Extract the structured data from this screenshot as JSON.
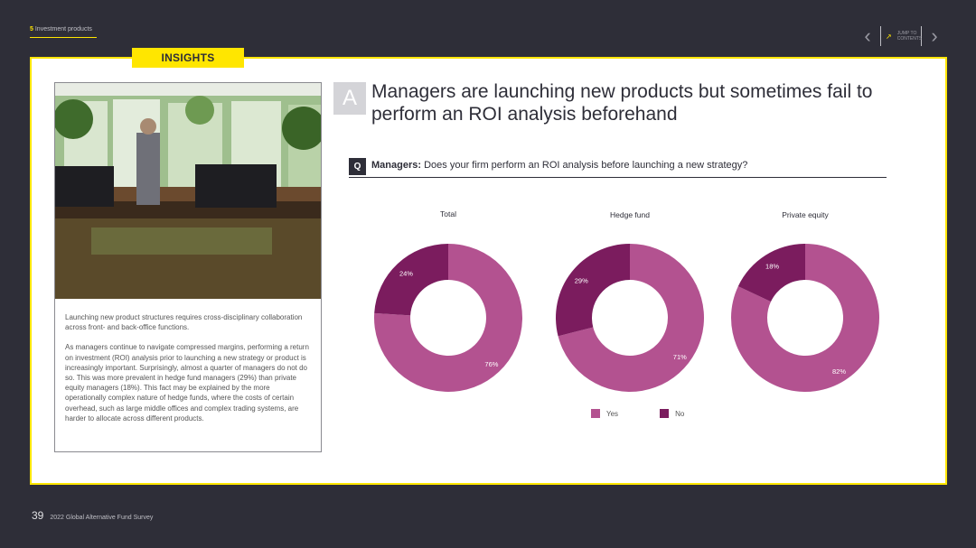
{
  "section": {
    "number": "5",
    "label": "Investment products"
  },
  "nav": {
    "prev_label": "‹",
    "next_label": "›",
    "jump_label": "JUMP TO CONTENTS"
  },
  "tag": "INSIGHTS",
  "card": {
    "paragraph1": "Launching new product structures requires cross-disciplinary collaboration across front- and back-office functions.",
    "paragraph2": "As managers continue to navigate compressed margins, performing a return on investment (ROI) analysis prior to launching a new strategy or product is increasingly important. Surprisingly, almost a quarter of managers do not do so. This was more prevalent in hedge fund managers (29%) than private equity managers (18%). This fact may be explained by the more operationally complex nature of hedge funds, where the costs of certain overhead, such as large middle offices and complex trading systems, are harder to allocate across different products."
  },
  "answer_letter": "A",
  "headline": "Managers are launching new products but sometimes fail to perform an ROI analysis beforehand",
  "question": {
    "letter": "Q",
    "prefix": "Managers:",
    "text": "Does your firm perform an ROI analysis before launching a new strategy?"
  },
  "colors": {
    "yes": "#b35290",
    "no": "#7b1c5e"
  },
  "chart_data": [
    {
      "type": "pie",
      "title": "Total",
      "categories": [
        "Yes",
        "No"
      ],
      "values": [
        76,
        24
      ],
      "labels": [
        "76%",
        "24%"
      ]
    },
    {
      "type": "pie",
      "title": "Hedge fund",
      "categories": [
        "Yes",
        "No"
      ],
      "values": [
        71,
        29
      ],
      "labels": [
        "71%",
        "29%"
      ]
    },
    {
      "type": "pie",
      "title": "Private equity",
      "categories": [
        "Yes",
        "No"
      ],
      "values": [
        82,
        18
      ],
      "labels": [
        "82%",
        "18%"
      ]
    }
  ],
  "legend": {
    "yes": "Yes",
    "no": "No"
  },
  "footer": {
    "page": "39",
    "title": "2022 Global Alternative Fund Survey"
  }
}
